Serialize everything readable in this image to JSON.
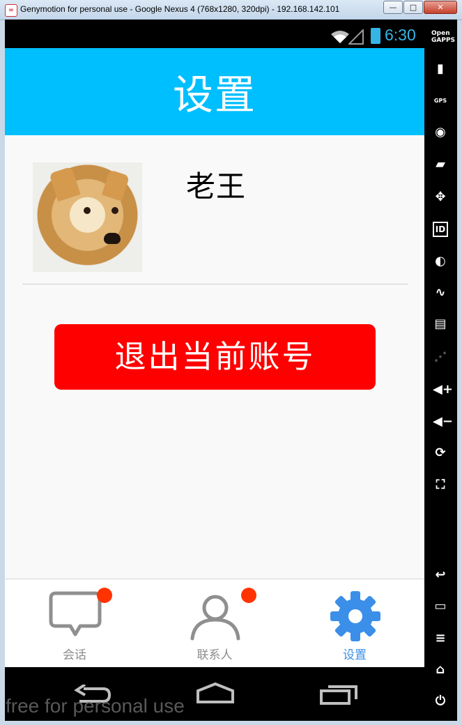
{
  "window": {
    "title": "Genymotion for personal use - Google Nexus 4 (768x1280, 320dpi) - 192.168.142.101",
    "icon_text": "∞",
    "minimize_symbol": "—",
    "maximize_symbol": "□",
    "close_symbol": "✕"
  },
  "status_bar": {
    "time": "6:30"
  },
  "app": {
    "title": "设置",
    "profile": {
      "name": "老王"
    },
    "logout_button": "退出当前账号"
  },
  "tabs": [
    {
      "label": "会话",
      "badge": true
    },
    {
      "label": "联系人",
      "badge": true
    },
    {
      "label": "设置",
      "active": true
    }
  ],
  "watermark": "free for personal use",
  "side_panel": {
    "opengapps_label": "Open\nGAPPS",
    "gps_label": "GPS",
    "id_label": "ID",
    "icons": {
      "battery": "▮",
      "camera": "◉",
      "video": "▰",
      "dpad": "✥",
      "media": "◐",
      "rss": "∿",
      "sms": "▤",
      "share": "⋰",
      "vol_up": "◀+",
      "vol_down": "◀−",
      "rotate": "⟳",
      "pixel": "⛶",
      "back": "↩",
      "recent": "▭",
      "menu": "≡",
      "home": "⌂",
      "power": "⏻"
    }
  },
  "colors": {
    "header": "#00bfff",
    "logout": "#ff0000",
    "active_tab": "#3b8fe8",
    "badge": "#ff3300"
  }
}
